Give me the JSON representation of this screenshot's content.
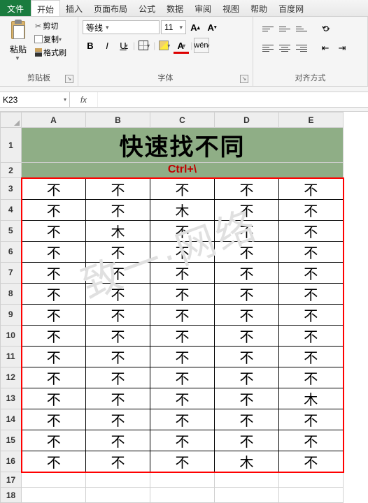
{
  "tabs": {
    "file": "文件",
    "home": "开始",
    "insert": "插入",
    "page_layout": "页面布局",
    "formulas": "公式",
    "data": "数据",
    "review": "审阅",
    "view": "视图",
    "help": "帮助",
    "baidu": "百度网"
  },
  "ribbon": {
    "clipboard": {
      "paste": "粘贴",
      "cut": "剪切",
      "copy": "复制",
      "format_painter": "格式刷",
      "group_label": "剪贴板"
    },
    "font": {
      "name": "等线",
      "size": "11",
      "bold": "B",
      "italic": "I",
      "underline": "U",
      "font_color_letter": "A",
      "wen": "wén",
      "group_label": "字体"
    },
    "alignment": {
      "group_label": "对齐方式"
    }
  },
  "namebox": {
    "ref": "K23"
  },
  "formula_bar": {
    "fx": "fx",
    "value": ""
  },
  "columns": [
    "A",
    "B",
    "C",
    "D",
    "E"
  ],
  "row_headers": [
    "1",
    "2",
    "3",
    "4",
    "5",
    "6",
    "7",
    "8",
    "9",
    "10",
    "11",
    "12",
    "13",
    "14",
    "15",
    "16",
    "17",
    "18"
  ],
  "sheet": {
    "title": "快速找不同",
    "subtitle": "Ctrl+\\",
    "rows": [
      [
        "不",
        "不",
        "不",
        "不",
        "不"
      ],
      [
        "不",
        "不",
        "木",
        "不",
        "不"
      ],
      [
        "不",
        "木",
        "不",
        "不",
        "不"
      ],
      [
        "不",
        "不",
        "不",
        "不",
        "不"
      ],
      [
        "不",
        "不",
        "不",
        "不",
        "不"
      ],
      [
        "不",
        "不",
        "不",
        "不",
        "不"
      ],
      [
        "不",
        "不",
        "不",
        "不",
        "不"
      ],
      [
        "不",
        "不",
        "不",
        "不",
        "不"
      ],
      [
        "不",
        "不",
        "不",
        "不",
        "不"
      ],
      [
        "不",
        "不",
        "不",
        "不",
        "不"
      ],
      [
        "不",
        "不",
        "不",
        "不",
        "木"
      ],
      [
        "不",
        "不",
        "不",
        "不",
        "不"
      ],
      [
        "不",
        "不",
        "不",
        "不",
        "不"
      ],
      [
        "不",
        "不",
        "不",
        "木",
        "不"
      ]
    ]
  },
  "watermark": "致一·网络"
}
